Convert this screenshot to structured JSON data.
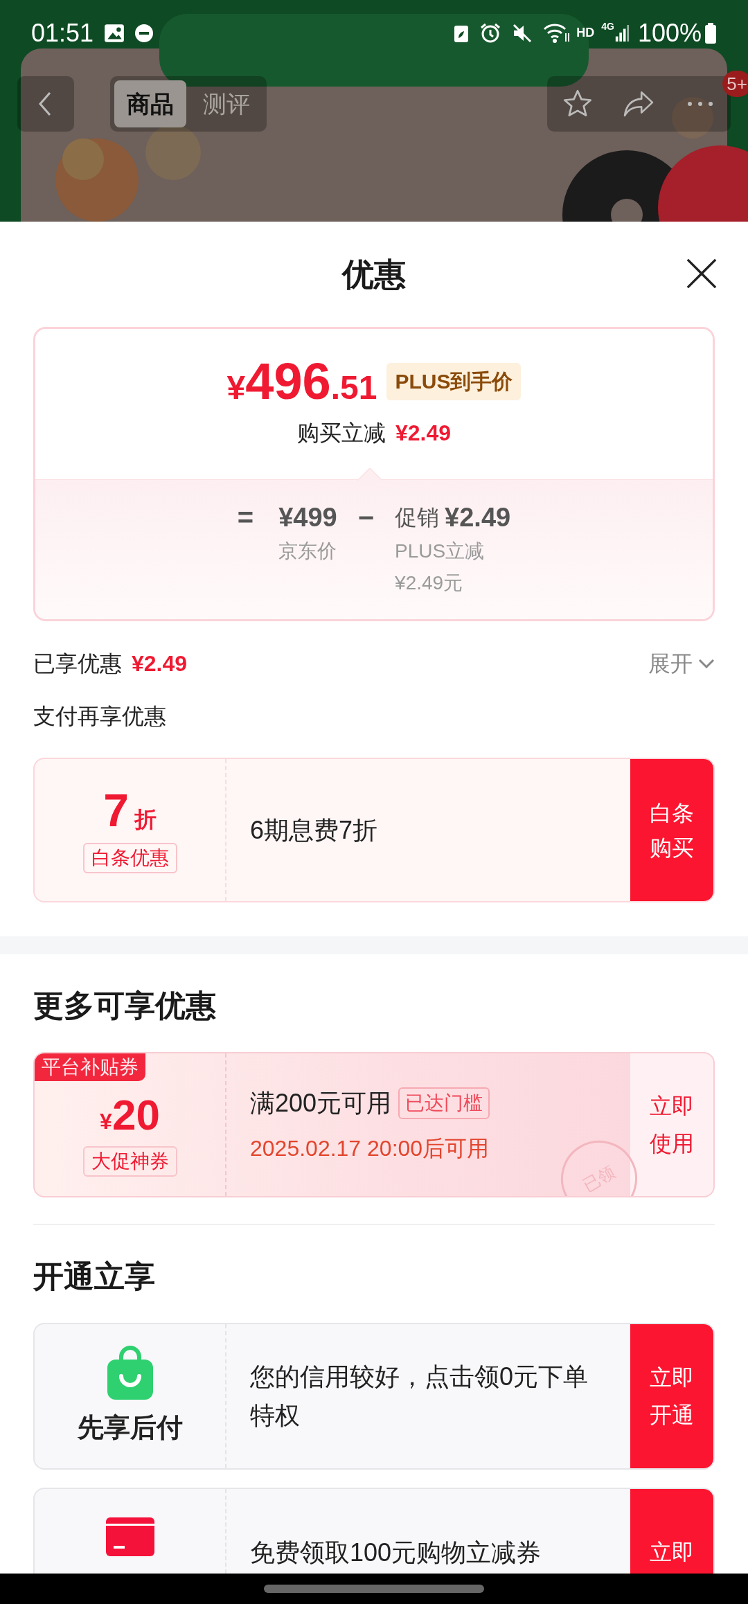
{
  "status_bar": {
    "time": "01:51",
    "indicators": [
      "HD",
      "4G"
    ],
    "battery": "100%"
  },
  "header": {
    "tabs": [
      {
        "label": "商品",
        "selected": true
      },
      {
        "label": "测评",
        "selected": false
      }
    ],
    "badge": "5+"
  },
  "sheet": {
    "title": "优惠"
  },
  "price_card": {
    "currency": "¥",
    "integer": "496",
    "decimal": ".51",
    "tag": "PLUS到手价",
    "reduce_label": "购买立减",
    "reduce_value": "¥2.49",
    "equals": "=",
    "base_price": "¥499",
    "base_label": "京东价",
    "minus": "−",
    "promo_label": "促销",
    "promo_value": "¥2.49",
    "promo_detail_lines": [
      "PLUS立减",
      "¥2.49元"
    ]
  },
  "enjoyed": {
    "label": "已享优惠",
    "value": "¥2.49",
    "toggle": "展开",
    "expanded": false
  },
  "sections": [
    {
      "title": "支付再享优惠",
      "kind": "plain",
      "offers": [
        {
          "kind": "discount",
          "value": "7",
          "unit": "折",
          "tag": "白条优惠",
          "desc": "6期息费7折",
          "button_lines": [
            "白条",
            "购买"
          ]
        }
      ]
    },
    {
      "title": "更多可享优惠",
      "kind": "heading",
      "offers": [
        {
          "kind": "coupon",
          "corner": "平台补贴券",
          "currency": "¥",
          "value": "20",
          "tag": "大促神券",
          "condition": "满200元可用",
          "badge": "已达门槛",
          "time": "2025.02.17 20:00后可用",
          "stamp": "已领",
          "button_lines": [
            "立即",
            "使用"
          ]
        }
      ]
    },
    {
      "title": "开通立享",
      "kind": "heading",
      "offers": [
        {
          "kind": "service",
          "name": "先享后付",
          "desc": "您的信用较好，点击领0元下单特权",
          "button_lines": [
            "立即",
            "开通"
          ]
        },
        {
          "kind": "service",
          "desc": "免费领取100元购物立减券",
          "button_lines": [
            "立即"
          ]
        }
      ]
    }
  ]
}
